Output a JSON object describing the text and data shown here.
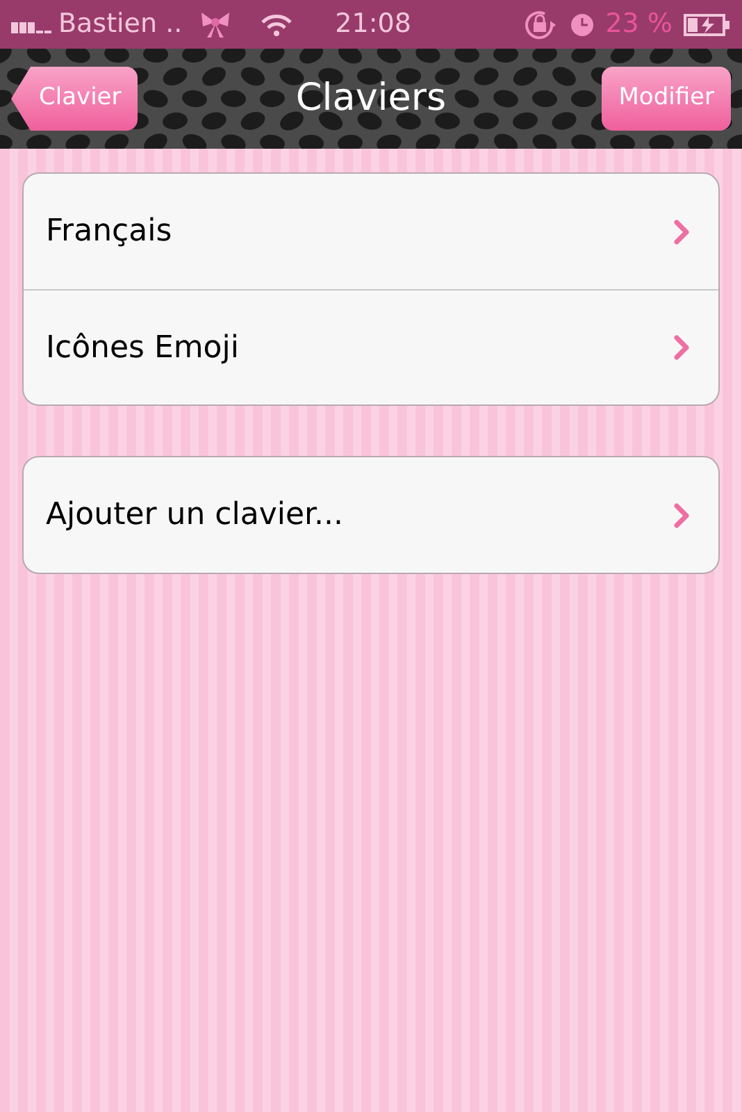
{
  "status_bar": {
    "carrier": "Bastien ..",
    "time": "21:08",
    "battery": "23 %"
  },
  "nav": {
    "back": "Clavier",
    "title": "Claviers",
    "action": "Modifier"
  },
  "groups": [
    {
      "rows": [
        {
          "label": "Français"
        },
        {
          "label": "Icônes Emoji"
        }
      ]
    },
    {
      "rows": [
        {
          "label": "Ajouter un clavier..."
        }
      ]
    }
  ]
}
